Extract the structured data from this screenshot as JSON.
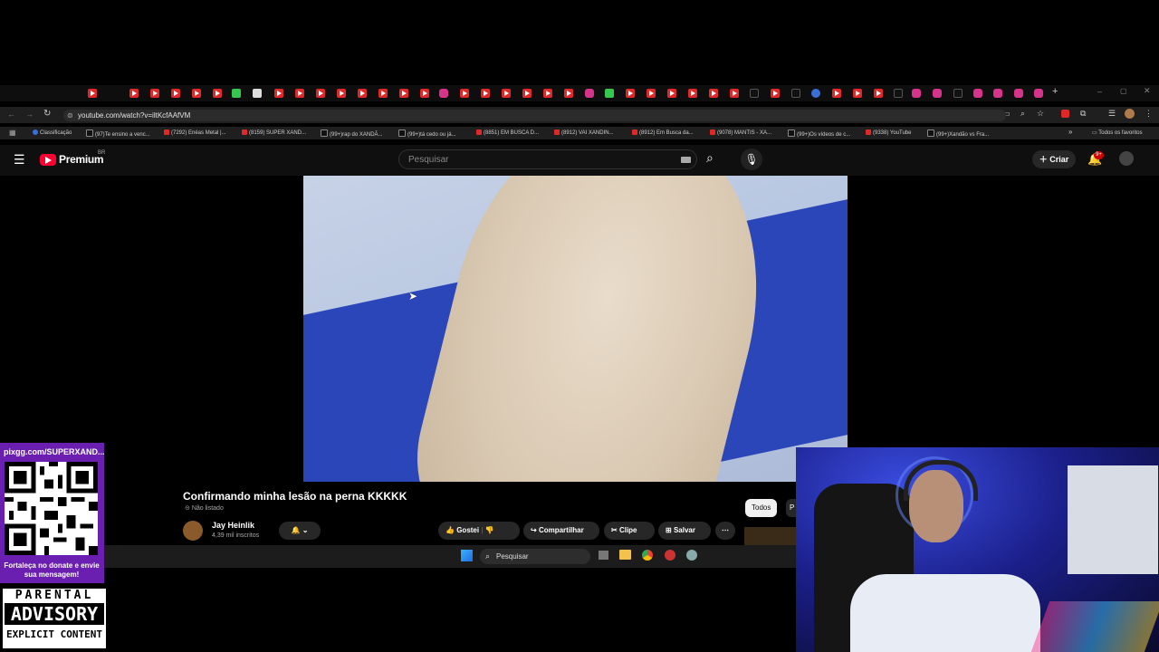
{
  "browser": {
    "url": "youtube.com/watch?v=iltKcfAAfVM",
    "bookmarks": [
      "Classificação",
      "(97)Te ensino a venc...",
      "(7292) Enéas Metal |...",
      "(8159) SUPER XAND...",
      "(99+)rap do XANDÃ...",
      "(99+)tá cedo ou já...",
      "(8851) EM BUSCA D...",
      "(8912) VAI XANDIN...",
      "(8912) Em Busca da...",
      "(9078) MANTIS - XA...",
      "(99+)Os vídeos de c...",
      "(9338) YouTube",
      "(99+)Xandão vs Fra..."
    ],
    "bookmarks_all": "Todos os favoritos"
  },
  "youtube": {
    "logo_text": "Premium",
    "logo_region": "BR",
    "search_placeholder": "Pesquisar",
    "create_label": "Criar",
    "notif_badge": "9+"
  },
  "video": {
    "title": "Confirmando minha lesão na perna KKKKK",
    "visibility": "Não listado",
    "channel_name": "Jay Heinlik",
    "subscribers": "4,39 mil inscritos",
    "actions": {
      "like": "Gostei",
      "share": "Compartilhar",
      "clip": "Clipe",
      "save": "Salvar"
    },
    "chip_all": "Todos",
    "chip_next": "P"
  },
  "taskbar": {
    "search_placeholder": "Pesquisar"
  },
  "overlay": {
    "pix_url": "pixgg.com/SUPERXAND...",
    "pix_caption": "Fortaleça no donate e envie sua mensagem!",
    "advisory_top": "PARENTAL",
    "advisory_mid": "ADVISORY",
    "advisory_bot": "EXPLICIT CONTENT"
  },
  "colors": {
    "yt_red": "#ff0033",
    "qr_purple": "#6a1fb0"
  }
}
